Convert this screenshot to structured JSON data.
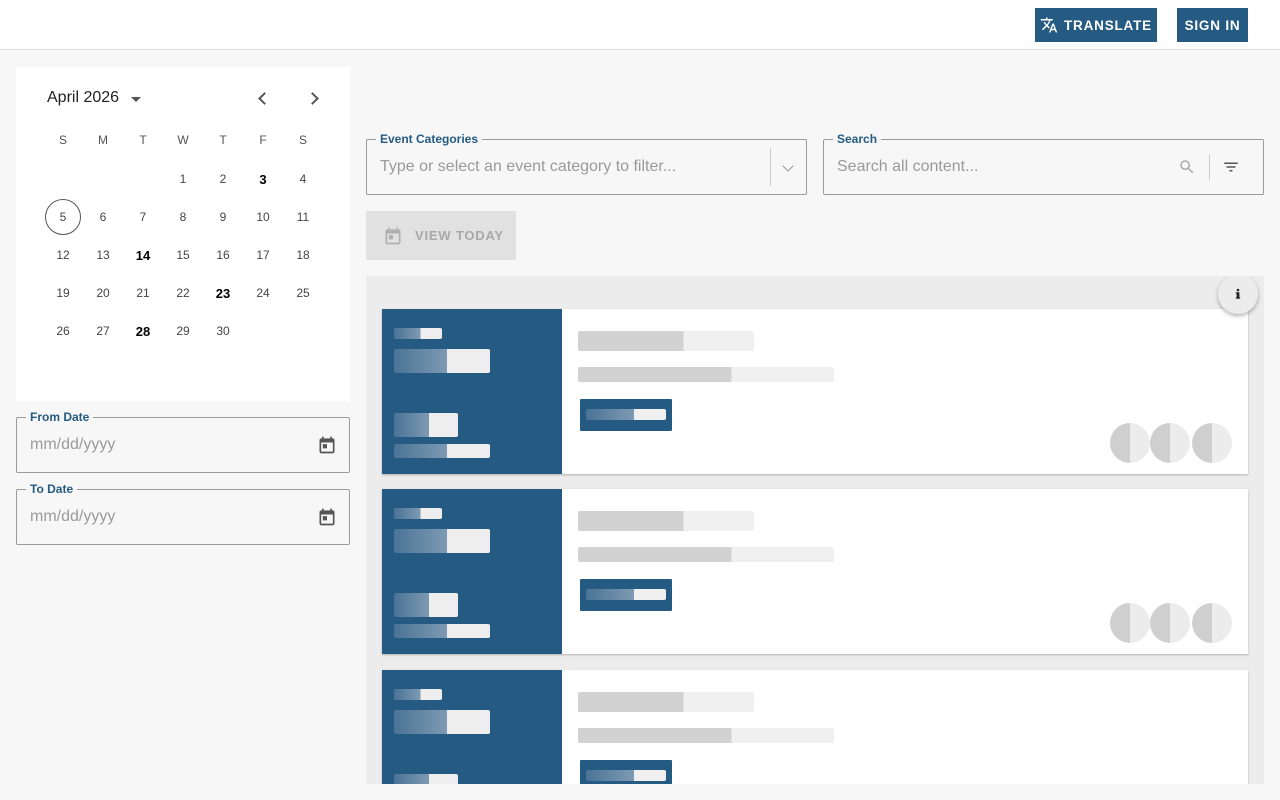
{
  "header": {
    "translate_label": "TRANSLATE",
    "signin_label": "SIGN IN",
    "accent_color": "#255a82"
  },
  "calendar": {
    "month_label": "April 2026",
    "weekdays": [
      "S",
      "M",
      "T",
      "W",
      "T",
      "F",
      "S"
    ],
    "today": 5,
    "bold_days": [
      3,
      14,
      23,
      28
    ],
    "weeks": [
      [
        null,
        null,
        null,
        1,
        2,
        3,
        4
      ],
      [
        5,
        6,
        7,
        8,
        9,
        10,
        11
      ],
      [
        12,
        13,
        14,
        15,
        16,
        17,
        18
      ],
      [
        19,
        20,
        21,
        22,
        23,
        24,
        25
      ],
      [
        26,
        27,
        28,
        29,
        30,
        null,
        null
      ]
    ]
  },
  "from_date": {
    "label": "From Date",
    "placeholder": "mm/dd/yyyy"
  },
  "to_date": {
    "label": "To Date",
    "placeholder": "mm/dd/yyyy"
  },
  "categories": {
    "label": "Event Categories",
    "placeholder": "Type or select an event category to filter..."
  },
  "search": {
    "label": "Search",
    "placeholder": "Search all content..."
  },
  "view_today": {
    "label": "VIEW TODAY"
  },
  "events": {
    "loading_cards": 3
  }
}
